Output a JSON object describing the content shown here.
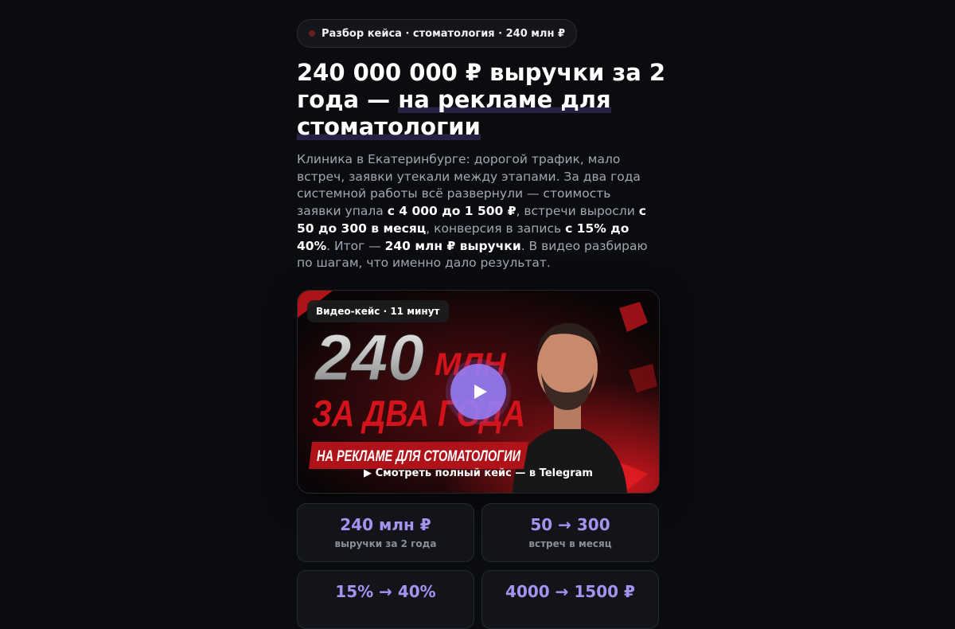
{
  "badge": {
    "text": "Разбор кейса · стоматология · 240 млн ₽"
  },
  "headline": {
    "part1": "240 000 000 ₽ выручки за 2 года — ",
    "highlight": "на рекламе для стоматологии"
  },
  "lead": {
    "t1": "Клиника в Екатеринбурге: дорогой трафик, мало встреч, заявки утекали между этапами. За два года системной работы всё развернули — стоимость заявки упала ",
    "b1": "с 4 000 до 1 500 ₽",
    "t2": ", встречи выросли ",
    "b2": "с 50 до 300 в месяц",
    "t3": ", конверсия в запись ",
    "b3": "с 15% до 40%",
    "t4": ". Итог — ",
    "b4": "240 млн ₽ выручки",
    "t5": ". В видео разбираю по шагам, что именно дало результат."
  },
  "video": {
    "badge": "Видео-кейс · 11 минут",
    "thumb_big": "240",
    "thumb_mln": "МЛН",
    "thumb_line2": "ЗА ДВА ГОДА",
    "thumb_banner": "НА РЕКЛАМЕ ДЛЯ СТОМАТОЛОГИИ",
    "link": "▶ Смотреть полный кейс — в Telegram",
    "icon": "play-icon"
  },
  "stats": [
    {
      "value": "240 млн ₽",
      "label": "выручки за 2 года"
    },
    {
      "value": "50 → 300",
      "label": "встреч в месяц"
    },
    {
      "value": "15% → 40%",
      "label": ""
    },
    {
      "value": "4000 → 1500 ₽",
      "label": ""
    }
  ],
  "colors": {
    "accent": "#a593f0",
    "background": "#0b0c10",
    "thumb_red": "#d3131b"
  }
}
